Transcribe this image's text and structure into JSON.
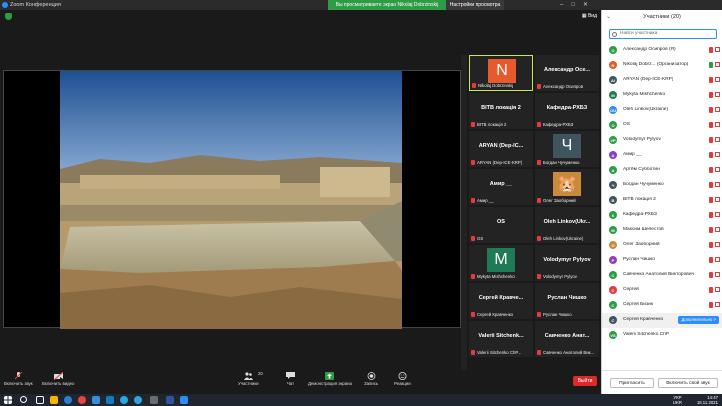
{
  "window": {
    "app_title": "Zoom Конференция",
    "share_banner": "Вы просматриваете экран Nikolaj Dobrzinskij",
    "view_options": "Настройки просмотра",
    "view_button": "Вид"
  },
  "grid": {
    "tiles": [
      {
        "title": "N",
        "footer": "Nikolaj Dobrzinskij",
        "avatar": true,
        "avatar_color": "#e65a2e",
        "active": true
      },
      {
        "title": "Александр Осе...",
        "footer": "Александр Осипров",
        "avatar": false
      },
      {
        "title": "ВІТВ локація 2",
        "footer": "ВІТВ локація 2",
        "avatar": false
      },
      {
        "title": "Кафедра-РХБЗ",
        "footer": "Кафедра-РХБЗ",
        "avatar": false
      },
      {
        "title": "ARYAN (Dep-IC...",
        "footer": "ARYAN (Dep-ICE-KRP)",
        "avatar": false
      },
      {
        "title": "Ч",
        "footer": "Богдан Чучуменко",
        "avatar": true,
        "avatar_color": "#3e5560"
      },
      {
        "title": "Амир __",
        "footer": "Амир __",
        "avatar": false
      },
      {
        "title": "",
        "footer": "Олег Заоборний",
        "avatar": true,
        "avatar_color": "#c98a3c"
      },
      {
        "title": "OS",
        "footer": "OS",
        "avatar": false
      },
      {
        "title": "Oleh Linkov(Ukr...",
        "footer": "Oleh Linkov(Ukraine)",
        "avatar": false
      },
      {
        "title": "M",
        "footer": "Mykyta Mishchenko",
        "avatar": true,
        "avatar_color": "#1f7a55"
      },
      {
        "title": "Volodymyr Pylyov",
        "footer": "Volodymyr Pylyov",
        "avatar": false
      },
      {
        "title": "Сергей Кравче...",
        "footer": "Сергей Кравченко",
        "avatar": false
      },
      {
        "title": "Руслан Чишко",
        "footer": "Руслан Чишко",
        "avatar": false
      },
      {
        "title": "Valerii Sitchenk...",
        "footer": "Valerii Sitchenko ChP...",
        "avatar": false
      },
      {
        "title": "Савченко Анат...",
        "footer": "Савченко Анатолий Вик...",
        "avatar": false
      }
    ]
  },
  "toolbar": {
    "audio": "Включить звук",
    "video": "Включить видео",
    "participants": "Участники",
    "participants_count": "20",
    "chat": "Чат",
    "share": "Демонстрация экрана",
    "record": "Запись",
    "reactions": "Реакции",
    "leave": "Выйти"
  },
  "panel": {
    "title": "Участники (20)",
    "search_placeholder": "Найти участника",
    "more_button": "Дополнительно >",
    "invite": "Пригласить",
    "unmute_me": "Включить свой звук",
    "participants": [
      {
        "name": "Александр Осипров (Я)",
        "initials": "О",
        "color": "#2e9b45"
      },
      {
        "name": "Nikolaj Dobrz... (Организатор)",
        "initials": "N",
        "color": "#e65a2e"
      },
      {
        "name": "ARYAN (Dep-ICE-KRP)",
        "initials": "AI",
        "color": "#3e5560"
      },
      {
        "name": "Mykyta Mishchenko",
        "initials": "M",
        "color": "#1f7a55"
      },
      {
        "name": "Oleh Linkov(Ukraine)",
        "initials": "OU",
        "color": "#2d8cff"
      },
      {
        "name": "OS",
        "initials": "O",
        "color": "#2e9b45"
      },
      {
        "name": "Volodymyr Pylyov",
        "initials": "VP",
        "color": "#2e9b45"
      },
      {
        "name": "Амир __",
        "initials": "A",
        "color": "#8a3fc4"
      },
      {
        "name": "Артём Субботин",
        "initials": "A",
        "color": "#2e9b45"
      },
      {
        "name": "Богдан Чучуменко",
        "initials": "Ч",
        "color": "#3e5560"
      },
      {
        "name": "ВІТВ локація 2",
        "initials": "В",
        "color": "#3e5560"
      },
      {
        "name": "Кафедра-РХБЗ",
        "initials": "К",
        "color": "#2e9b45"
      },
      {
        "name": "Максим Шелестов",
        "initials": "М",
        "color": "#2e9b45"
      },
      {
        "name": "Олег Заоборний",
        "initials": "О",
        "color": "#c98a3c"
      },
      {
        "name": "Руслан Чишко",
        "initials": "Р",
        "color": "#8a3fc4"
      },
      {
        "name": "Савченко Анатолий Викторович",
        "initials": "С",
        "color": "#2e9b45"
      },
      {
        "name": "Сергей",
        "initials": "С",
        "color": "#e23b3b"
      },
      {
        "name": "Сергей Бизик",
        "initials": "С",
        "color": "#2e9b45"
      },
      {
        "name": "Сергей Кравченко",
        "initials": "С",
        "color": "#3e5560",
        "highlight": true
      },
      {
        "name": "Valerii Sitchenko ChP",
        "initials": "VS",
        "color": "#2e9b45"
      }
    ]
  },
  "taskbar": {
    "lang_top": "УКР",
    "lang_bottom": "UKR",
    "time": "14:47",
    "date": "18.11.2021"
  }
}
